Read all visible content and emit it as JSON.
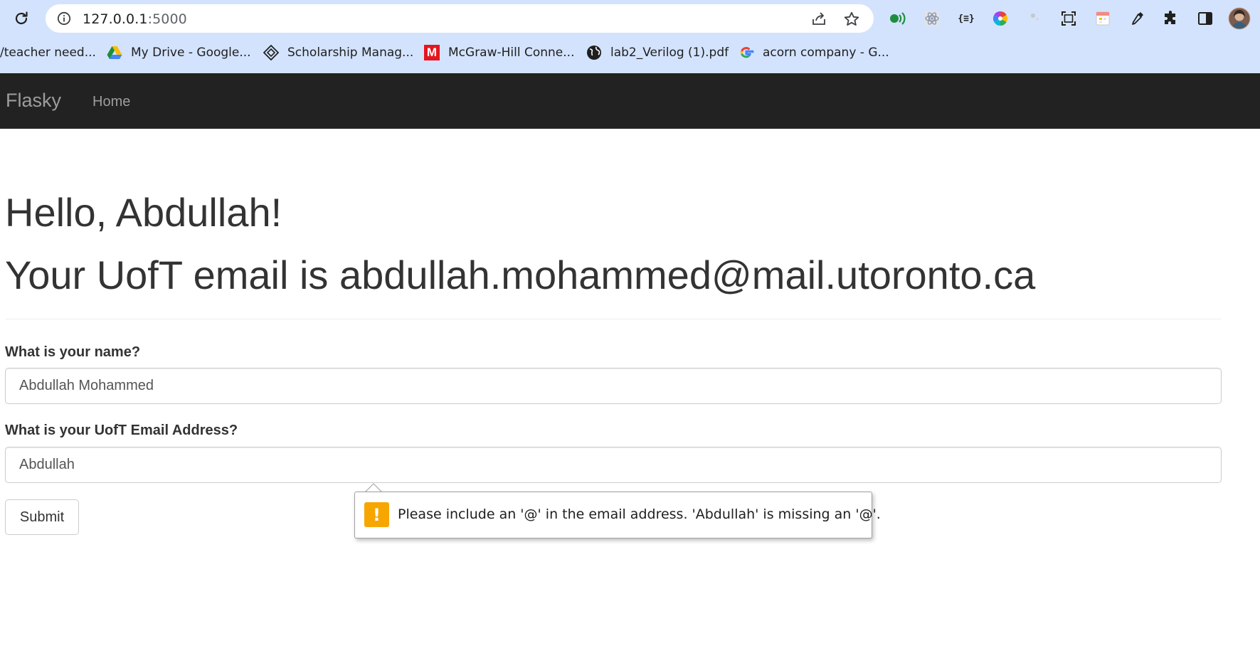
{
  "browser": {
    "url_host": "127.0.0.1",
    "url_port": ":5000",
    "bookmarks": [
      {
        "label": "/teacher need...",
        "icon": "globe-icon"
      },
      {
        "label": "My Drive - Google...",
        "icon": "google-drive-icon"
      },
      {
        "label": "Scholarship Manag...",
        "icon": "diamond-logo-icon"
      },
      {
        "label": "McGraw-Hill Conne...",
        "icon": "mcgraw-hill-icon"
      },
      {
        "label": "lab2_Verilog (1).pdf",
        "icon": "globe-icon"
      },
      {
        "label": "acorn company - G...",
        "icon": "google-icon"
      }
    ],
    "extensions": [
      "audio-extension-icon",
      "react-devtools-icon",
      "json-formatter-icon",
      "color-picker-icon",
      "dots-extension-icon",
      "screenshot-icon",
      "calendar-extension-icon",
      "eyedropper-icon",
      "puzzle-icon",
      "side-panel-icon",
      "profile-avatar"
    ]
  },
  "navbar": {
    "brand": "Flasky",
    "home": "Home"
  },
  "page": {
    "greeting": "Hello, Abdullah!",
    "email_line": "Your UofT email is abdullah.mohammed@mail.utoronto.ca"
  },
  "form": {
    "name_label": "What is your name?",
    "name_value": "Abdullah Mohammed",
    "email_label": "What is your UofT Email Address?",
    "email_value": "Abdullah",
    "submit_label": "Submit"
  },
  "validation": {
    "message": "Please include an '@' in the email address. 'Abdullah' is missing an '@'.",
    "warning_color": "#f7a600"
  },
  "colors": {
    "chrome_bg": "#d3e3fd",
    "navbar_bg": "#222222",
    "navbar_text": "#9d9d9d",
    "text": "#333333"
  }
}
